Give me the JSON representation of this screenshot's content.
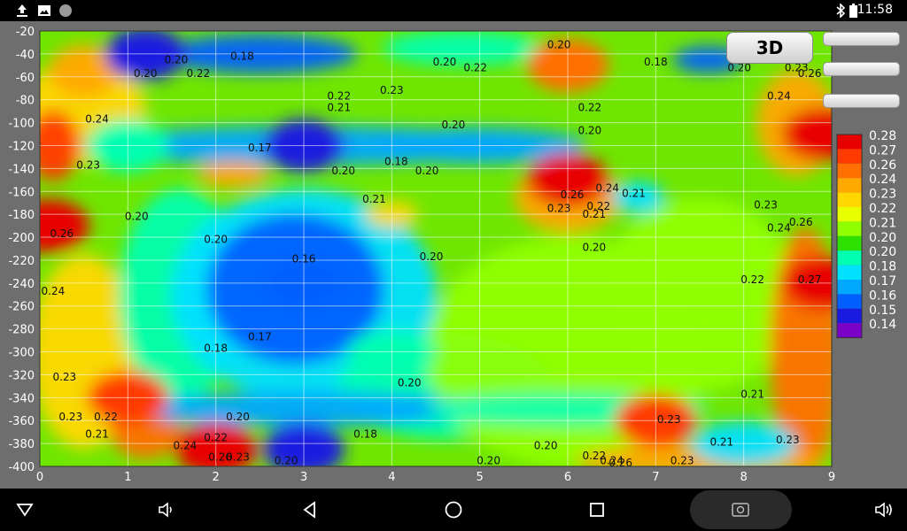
{
  "status_bar": {
    "time": "11:58",
    "left_icons": [
      "upload-icon",
      "image-icon",
      "circle-notification-icon"
    ],
    "right_icons": [
      "bluetooth-icon",
      "battery-icon"
    ]
  },
  "buttons": {
    "view_3d": "3D"
  },
  "nav_icons": [
    "back-triangle-icon",
    "volume-down-icon",
    "back-icon",
    "home-icon",
    "recents-icon",
    "screenshot-icon",
    "volume-up-icon"
  ],
  "chart_data": {
    "type": "heatmap",
    "title": "",
    "xlabel": "",
    "ylabel": "",
    "xlim": [
      0,
      9
    ],
    "ylim": [
      -400,
      -20
    ],
    "x_ticks": [
      "0",
      "1",
      "2",
      "3",
      "4",
      "5",
      "6",
      "7",
      "8",
      "9"
    ],
    "y_ticks": [
      "-20",
      "-40",
      "-60",
      "-80",
      "-100",
      "-120",
      "-140",
      "-160",
      "-180",
      "-200",
      "-220",
      "-240",
      "-260",
      "-280",
      "-300",
      "-320",
      "-340",
      "-360",
      "-380",
      "-400"
    ],
    "grid": true,
    "colorbar": {
      "position": "right",
      "labels": [
        "0.28",
        "0.27",
        "0.26",
        "0.24",
        "0.23",
        "0.22",
        "0.21",
        "0.20",
        "0.20",
        "0.18",
        "0.17",
        "0.16",
        "0.15",
        "0.14"
      ],
      "colors": [
        "#e80000",
        "#ff3a00",
        "#ff7000",
        "#ffa800",
        "#ffd800",
        "#e8ff00",
        "#90ff00",
        "#2ee000",
        "#00ffb0",
        "#00e0ff",
        "#00a8ff",
        "#0060ff",
        "#1a1ae0",
        "#7a00c8"
      ]
    },
    "features": [
      {
        "x": 3.0,
        "y": -240,
        "value": 0.16
      },
      {
        "x": 1.0,
        "y": -120,
        "value": 0.19
      },
      {
        "x": 3.0,
        "y": -120,
        "value": 0.15
      },
      {
        "x": 6.0,
        "y": -150,
        "value": 0.28
      },
      {
        "x": 6.0,
        "y": -50,
        "value": 0.26
      },
      {
        "x": 0.1,
        "y": -190,
        "value": 0.28
      },
      {
        "x": 8.9,
        "y": -240,
        "value": 0.28
      },
      {
        "x": 1.0,
        "y": -340,
        "value": 0.27
      },
      {
        "x": 2.0,
        "y": -385,
        "value": 0.28
      },
      {
        "x": 3.0,
        "y": -385,
        "value": 0.15
      },
      {
        "x": 1.2,
        "y": -40,
        "value": 0.15
      },
      {
        "x": 7.0,
        "y": -360,
        "value": 0.27
      },
      {
        "x": 8.9,
        "y": -110,
        "value": 0.28
      }
    ],
    "contour_labels": [
      {
        "x": 0.65,
        "y": -100,
        "text": "0.24"
      },
      {
        "x": 0.55,
        "y": -140,
        "text": "0.23"
      },
      {
        "x": 1.2,
        "y": -60,
        "text": "0.20"
      },
      {
        "x": 1.55,
        "y": -48,
        "text": "0.20"
      },
      {
        "x": 1.8,
        "y": -60,
        "text": "0.22"
      },
      {
        "x": 2.3,
        "y": -45,
        "text": "0.18"
      },
      {
        "x": 3.4,
        "y": -90,
        "text": "0.21"
      },
      {
        "x": 3.4,
        "y": -80,
        "text": "0.22"
      },
      {
        "x": 4.0,
        "y": -75,
        "text": "0.23"
      },
      {
        "x": 4.6,
        "y": -50,
        "text": "0.20"
      },
      {
        "x": 4.95,
        "y": -55,
        "text": "0.22"
      },
      {
        "x": 5.9,
        "y": -35,
        "text": "0.20"
      },
      {
        "x": 7.0,
        "y": -50,
        "text": "0.18"
      },
      {
        "x": 7.95,
        "y": -55,
        "text": "0.20"
      },
      {
        "x": 6.25,
        "y": -90,
        "text": "0.22"
      },
      {
        "x": 6.25,
        "y": -110,
        "text": "0.20"
      },
      {
        "x": 4.7,
        "y": -105,
        "text": "0.20"
      },
      {
        "x": 4.05,
        "y": -137,
        "text": "0.18"
      },
      {
        "x": 4.4,
        "y": -145,
        "text": "0.20"
      },
      {
        "x": 2.5,
        "y": -125,
        "text": "0.17"
      },
      {
        "x": 3.45,
        "y": -145,
        "text": "0.20"
      },
      {
        "x": 1.1,
        "y": -185,
        "text": "0.20"
      },
      {
        "x": 2.0,
        "y": -205,
        "text": "0.20"
      },
      {
        "x": 3.0,
        "y": -222,
        "text": "0.16"
      },
      {
        "x": 4.45,
        "y": -220,
        "text": "0.20"
      },
      {
        "x": 3.8,
        "y": -170,
        "text": "0.21"
      },
      {
        "x": 6.3,
        "y": -183,
        "text": "0.21"
      },
      {
        "x": 6.3,
        "y": -212,
        "text": "0.20"
      },
      {
        "x": 8.25,
        "y": -175,
        "text": "0.23"
      },
      {
        "x": 8.1,
        "y": -240,
        "text": "0.22"
      },
      {
        "x": 8.75,
        "y": -240,
        "text": "0.27"
      },
      {
        "x": 8.4,
        "y": -195,
        "text": "0.24"
      },
      {
        "x": 8.65,
        "y": -190,
        "text": "0.26"
      },
      {
        "x": 0.15,
        "y": -250,
        "text": "0.24"
      },
      {
        "x": 0.28,
        "y": -325,
        "text": "0.23"
      },
      {
        "x": 0.35,
        "y": -360,
        "text": "0.23"
      },
      {
        "x": 0.65,
        "y": -375,
        "text": "0.21"
      },
      {
        "x": 0.75,
        "y": -360,
        "text": "0.22"
      },
      {
        "x": 2.0,
        "y": -300,
        "text": "0.18"
      },
      {
        "x": 2.5,
        "y": -290,
        "text": "0.17"
      },
      {
        "x": 4.2,
        "y": -330,
        "text": "0.20"
      },
      {
        "x": 3.7,
        "y": -375,
        "text": "0.18"
      },
      {
        "x": 2.25,
        "y": -360,
        "text": "0.20"
      },
      {
        "x": 2.0,
        "y": -378,
        "text": "0.22"
      },
      {
        "x": 2.25,
        "y": -395,
        "text": "0.23"
      },
      {
        "x": 1.65,
        "y": -385,
        "text": "0.24"
      },
      {
        "x": 2.05,
        "y": -395,
        "text": "0.26"
      },
      {
        "x": 2.8,
        "y": -398,
        "text": "0.20"
      },
      {
        "x": 5.1,
        "y": -398,
        "text": "0.20"
      },
      {
        "x": 5.75,
        "y": -385,
        "text": "0.20"
      },
      {
        "x": 6.3,
        "y": -394,
        "text": "0.22"
      },
      {
        "x": 6.5,
        "y": -398,
        "text": "0.24"
      },
      {
        "x": 6.6,
        "y": -400,
        "text": "0.26"
      },
      {
        "x": 7.3,
        "y": -398,
        "text": "0.23"
      },
      {
        "x": 8.5,
        "y": -380,
        "text": "0.23"
      },
      {
        "x": 7.75,
        "y": -382,
        "text": "0.21"
      },
      {
        "x": 8.1,
        "y": -340,
        "text": "0.21"
      },
      {
        "x": 7.15,
        "y": -362,
        "text": "0.23"
      },
      {
        "x": 6.05,
        "y": -166,
        "text": "0.26"
      },
      {
        "x": 6.45,
        "y": -160,
        "text": "0.24"
      },
      {
        "x": 6.35,
        "y": -176,
        "text": "0.22"
      },
      {
        "x": 5.9,
        "y": -178,
        "text": "0.23"
      },
      {
        "x": 8.75,
        "y": -60,
        "text": "0.26"
      },
      {
        "x": 8.4,
        "y": -80,
        "text": "0.24"
      },
      {
        "x": 8.6,
        "y": -55,
        "text": "0.23"
      },
      {
        "x": 6.75,
        "y": -165,
        "text": "0.21"
      },
      {
        "x": 0.25,
        "y": -200,
        "text": "0.26"
      }
    ]
  }
}
